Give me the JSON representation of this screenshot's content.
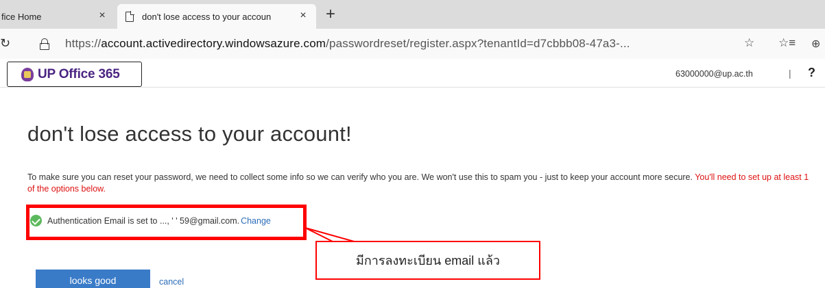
{
  "browser": {
    "tabs": [
      {
        "title": "fice Home",
        "close": "×"
      },
      {
        "title": "don't lose access to your accoun",
        "close": "×"
      }
    ],
    "new_tab": "+",
    "refresh_glyph": "↻",
    "url": {
      "prefix": "https://",
      "domain": "account.activedirectory.windowsazure.com",
      "path": "/passwordreset/register.aspx?tenantId=d7cbbb08-47a3-..."
    },
    "star_glyph": "☆",
    "favorites_glyph": "☆≡",
    "collections_glyph": "⊕"
  },
  "header": {
    "logo_text": "UP Office 365",
    "user_email": "63000000@up.ac.th",
    "separator": "|",
    "help": "?"
  },
  "main": {
    "heading": "don't lose access to your account!",
    "info_text": "To make sure you can reset your password, we need to collect some info so we can verify who you are. We won't use this to spam you - just to keep your account more secure.",
    "info_warning": "You'll need to set up at least 1 of the options below.",
    "auth_email_text": "Authentication Email is set to ...,   ' ' 59@gmail.com.",
    "change_label": "Change",
    "looks_good_label": "looks good",
    "cancel_label": "cancel"
  },
  "annotation": {
    "callout_text": "มีการลงทะเบียน email แล้ว",
    "color": "#ff0000"
  },
  "colors": {
    "brand": "#4b2582",
    "primary_button": "#3a7bc8",
    "link": "#2b6cb8",
    "success": "#5cb85c",
    "warning_text": "#dd1111"
  }
}
